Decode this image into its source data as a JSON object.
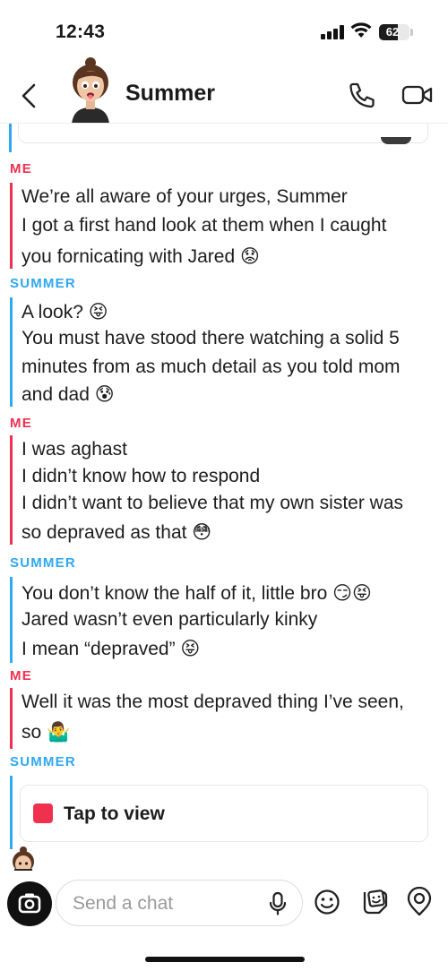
{
  "status_bar": {
    "time": "12:43",
    "battery": "62",
    "battery_level": 0.62
  },
  "header": {
    "contact_name": "Summer",
    "icons": [
      "back-chevron-icon",
      "bitmoji-avatar",
      "phone-icon",
      "video-camera-icon"
    ]
  },
  "messages": [
    {
      "sender": "ME",
      "lines": [
        "We’re all aware of your urges, Summer",
        "I got a first hand look at them when I caught",
        "you fornicating with Jared 😟"
      ]
    },
    {
      "sender": "SUMMER",
      "lines": [
        "A look? 😝",
        "You must have stood there watching a solid 5",
        "minutes from as much detail as you told mom",
        "and dad 😰"
      ]
    },
    {
      "sender": "ME",
      "lines": [
        "I was aghast",
        "I didn’t know how to respond",
        "I didn’t want to believe that my own sister was",
        "so depraved as that 😳"
      ]
    },
    {
      "sender": "SUMMER",
      "lines": [
        "You don’t know the half of it, little bro 😏😝",
        "Jared wasn’t even particularly kinky",
        "I mean “depraved” 😝"
      ]
    },
    {
      "sender": "ME",
      "lines": [
        "Well it was the most depraved thing I’ve seen,",
        "so 🤷‍♂️"
      ]
    },
    {
      "sender": "SUMMER",
      "lines": []
    }
  ],
  "snap": {
    "label": "Tap to view",
    "color": "#f0304f"
  },
  "composer": {
    "placeholder": "Send a chat",
    "icons": [
      "camera-icon",
      "microphone-icon",
      "smiley-icon",
      "sticker-icon",
      "bitmoji-icon"
    ]
  },
  "colors": {
    "me": "#f0304f",
    "summer": "#2ea8f0"
  }
}
